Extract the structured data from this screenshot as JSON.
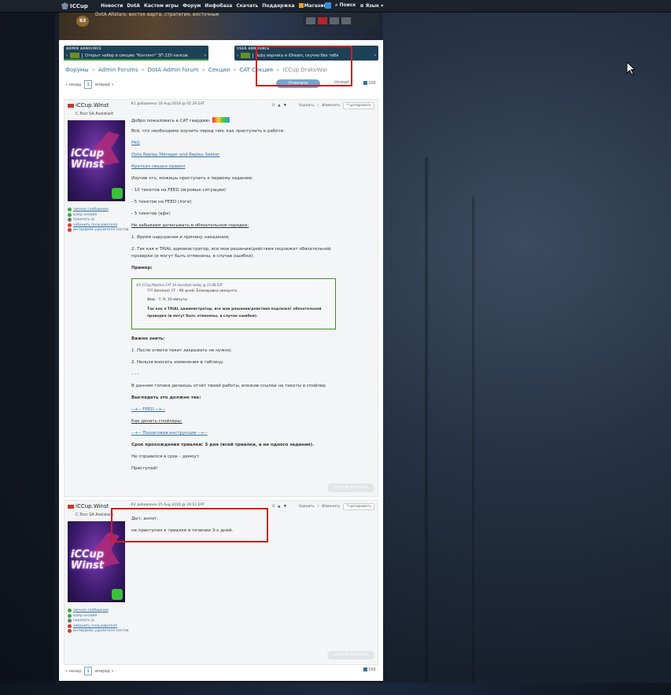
{
  "nav": {
    "logo": "ICCup",
    "items": [
      "Новости",
      "DotA",
      "Кастом игры",
      "Форум",
      "Инфобаза",
      "Скачать",
      "Поддержка",
      "Магазин"
    ],
    "search": "Поиск",
    "language": "Язык"
  },
  "banner": {
    "level": "63",
    "caption": "DotA Allstars: восток варта, стратегия, восточные"
  },
  "announcements": {
    "admin": {
      "label": "ADMIN ANNOUNCE",
      "text": "Открыт набор в секцию \"Контент\" ЗП 220 капсов"
    },
    "user": {
      "label": "USER ANNOUNCE",
      "text": "Ruby вернись в iDream, скучно без тебя"
    }
  },
  "breadcrumb": [
    "Форумы",
    "Admin Forums",
    "DotA Admin forum",
    "Секции",
    "CAT Секция",
    "iCCup.DrakoWar"
  ],
  "pager": {
    "prev": "« назад",
    "page": "1",
    "next": "вперед »",
    "count": "100"
  },
  "reply_button": "Ответить",
  "unread": "Unread",
  "posts": [
    {
      "author": "iCCup.Winst",
      "role": "C.Tour SA Assistant",
      "avatar_text": "iCCup Winst",
      "meta": "#1 добавлено 16 Aug 2018 @ 01:29 EAT",
      "actions": {
        "votes": "0",
        "delete": "Удалить",
        "edit": "Изменить",
        "quote": "цитировать"
      },
      "links": [
        "личное сообщение",
        "юзер онлайн",
        "показать ip",
        "забанить пользователя",
        "интерфейс удалителя постов"
      ],
      "lines": [
        "Добро пожаловать в CAT гвардию.",
        "Всё, что необходимо изучить перед тем, как приступить к работе:",
        "FAQ",
        "Dota Replay Manager and Replay Seeker",
        "Краткая сводка правил",
        "Изучив это, можешь приступать к первому заданию:",
        "- 10 тикетов на FEED (игровые ситуации)",
        "- 5 тикетов на FEED (логи)",
        "- 5 тикетов (афк)",
        "Не забываем дописывать в обязательном порядке:",
        "1. Время нарушения и причину наказания;",
        "2. Так как я TRIAL администратор, все мои решения/действия подлежат обязательной",
        "проверке (и могут быть отменены, в случае ошибки).",
        "Пример:",
        "Важно знать:",
        "1. После ответа тикет закрывать не нужно;",
        "2. Нельзя вносить изменения в таблицу.",
        "- - -",
        "В данном топике делаешь отчёт твоей работы, вложив ссылки на тикеты в спойлер.",
        "Выглядеть это должно так:",
        "--+-- FEED --+--",
        "Как делать спойлеры:",
        "--+-- Пошаговая инструкция --+--",
        "Срок прохождения триалки: 3 дня (всей триалки, а не одного задания).",
        "Не справился в срок - демоут.",
        "Приступай!"
      ],
      "example": {
        "meta": "#2  iCCup.Marklus  CAT SA Assistant  today @ 21:08 EAT",
        "line1": "??? dominus! FF - 90 дней. Блокировка аккаунта.",
        "line2": "Фид - 7, 9, 10 минуты",
        "line3": "Так как я TRIAL администратор, все мои решения/действия подлежат обязательной",
        "line4": "проверке (и могут быть отменены, в случае ошибки)."
      },
      "old_comment": "СТАРЫЙ КОММЕНТ"
    },
    {
      "author": "iCCup.Winst",
      "role": "C.Tour SA Assistant",
      "avatar_text": "iCCup Winst",
      "meta": "#2 добавлено 25 Aug 2018 @ 20:11 EAT",
      "actions": {
        "votes": "0",
        "delete": "Удалить",
        "edit": "Изменить",
        "quote": "цитировать"
      },
      "links": [
        "личное сообщение",
        "юзер онлайн",
        "показать ip",
        "забанить пользователя",
        "интерфейс удалителя постов"
      ],
      "lines": [
        "Дыт, анлот.",
        "не приступил к триалке в течении 3-х дней."
      ],
      "old_comment": "СТАРЫЙ КОММЕНТ"
    }
  ]
}
